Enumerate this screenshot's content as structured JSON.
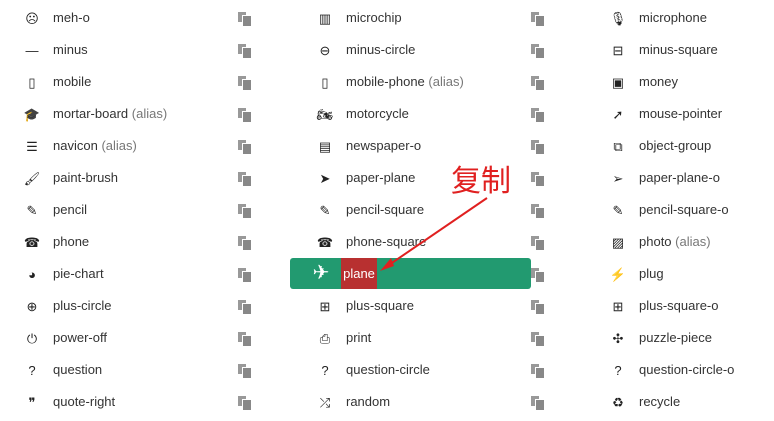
{
  "columns": [
    [
      {
        "label": "meh-o",
        "icon": "meh-o-icon",
        "glyph": "☹"
      },
      {
        "label": "minus",
        "icon": "minus-icon",
        "glyph": "—"
      },
      {
        "label": "mobile",
        "icon": "mobile-icon",
        "glyph": "▯"
      },
      {
        "label": "mortar-board",
        "alias": "(alias)",
        "icon": "mortar-board-icon",
        "glyph": "🎓"
      },
      {
        "label": "navicon",
        "alias": "(alias)",
        "icon": "navicon-icon",
        "glyph": "☰"
      },
      {
        "label": "paint-brush",
        "icon": "paint-brush-icon",
        "glyph": "🖌"
      },
      {
        "label": "pencil",
        "icon": "pencil-icon",
        "glyph": "✎"
      },
      {
        "label": "phone",
        "icon": "phone-icon",
        "glyph": "☎"
      },
      {
        "label": "pie-chart",
        "icon": "pie-chart-icon",
        "glyph": "◕"
      },
      {
        "label": "plus-circle",
        "icon": "plus-circle-icon",
        "glyph": "⊕"
      },
      {
        "label": "power-off",
        "icon": "power-off-icon",
        "glyph": "⏻"
      },
      {
        "label": "question",
        "icon": "question-icon",
        "glyph": "?"
      },
      {
        "label": "quote-right",
        "icon": "quote-right-icon",
        "glyph": "❞"
      }
    ],
    [
      {
        "label": "microchip",
        "icon": "microchip-icon",
        "glyph": "▥"
      },
      {
        "label": "minus-circle",
        "icon": "minus-circle-icon",
        "glyph": "⊖"
      },
      {
        "label": "mobile-phone",
        "alias": "(alias)",
        "icon": "mobile-phone-icon",
        "glyph": "▯"
      },
      {
        "label": "motorcycle",
        "icon": "motorcycle-icon",
        "glyph": "🏍"
      },
      {
        "label": "newspaper-o",
        "icon": "newspaper-o-icon",
        "glyph": "▤"
      },
      {
        "label": "paper-plane",
        "icon": "paper-plane-icon",
        "glyph": "➤"
      },
      {
        "label": "pencil-square",
        "icon": "pencil-square-icon",
        "glyph": "✎"
      },
      {
        "label": "phone-square",
        "icon": "phone-square-icon",
        "glyph": "☎"
      },
      {
        "label": "plane",
        "icon": "plane-icon",
        "glyph": "✈",
        "highlighted": true
      },
      {
        "label": "plus-square",
        "icon": "plus-square-icon",
        "glyph": "⊞"
      },
      {
        "label": "print",
        "icon": "print-icon",
        "glyph": "⎙"
      },
      {
        "label": "question-circle",
        "icon": "question-circle-icon",
        "glyph": "?"
      },
      {
        "label": "random",
        "icon": "random-icon",
        "glyph": "⤮"
      }
    ],
    [
      {
        "label": "microphone",
        "icon": "microphone-icon",
        "glyph": "🎙"
      },
      {
        "label": "minus-square",
        "icon": "minus-square-icon",
        "glyph": "⊟"
      },
      {
        "label": "money",
        "icon": "money-icon",
        "glyph": "▣"
      },
      {
        "label": "mouse-pointer",
        "icon": "mouse-pointer-icon",
        "glyph": "➚"
      },
      {
        "label": "object-group",
        "icon": "object-group-icon",
        "glyph": "⧉"
      },
      {
        "label": "paper-plane-o",
        "icon": "paper-plane-o-icon",
        "glyph": "➢"
      },
      {
        "label": "pencil-square-o",
        "icon": "pencil-square-o-icon",
        "glyph": "✎"
      },
      {
        "label": "photo",
        "alias": "(alias)",
        "icon": "photo-icon",
        "glyph": "▨"
      },
      {
        "label": "plug",
        "icon": "plug-icon",
        "glyph": "⚡"
      },
      {
        "label": "plus-square-o",
        "icon": "plus-square-o-icon",
        "glyph": "⊞"
      },
      {
        "label": "puzzle-piece",
        "icon": "puzzle-piece-icon",
        "glyph": "✣"
      },
      {
        "label": "question-circle-o",
        "icon": "question-circle-o-icon",
        "glyph": "?"
      },
      {
        "label": "recycle",
        "icon": "recycle-icon",
        "glyph": "♻"
      }
    ]
  ],
  "highlight": {
    "label": "plane",
    "icon": "plane-icon",
    "glyph": "✈",
    "bg": "#229a70",
    "label_bg": "#b83030"
  },
  "annotation": {
    "text": "复制",
    "color": "#e02020"
  }
}
